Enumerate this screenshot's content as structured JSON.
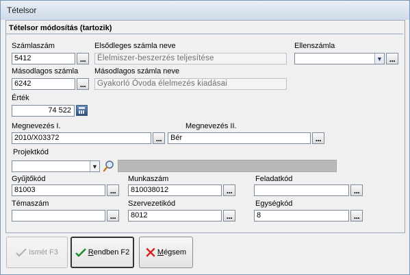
{
  "window": {
    "title": "Tételsor"
  },
  "group": {
    "title": "Tételsor módosítás (tartozik)"
  },
  "fields": {
    "szamlaszam": {
      "label": "Számlaszám",
      "value": "5412"
    },
    "elsodleges": {
      "label": "Elsődleges számla neve",
      "value": "Élelmiszer-beszerzés teljesítése"
    },
    "ellenszamla": {
      "label": "Ellenszámla",
      "value": ""
    },
    "masodlagos": {
      "label": "Másodlagos számla",
      "value": "6242"
    },
    "masodlagos_nev": {
      "label": "Másodlagos számla neve",
      "value": "Gyakorló Óvoda élelmezés kiadásai"
    },
    "ertek": {
      "label": "Érték",
      "value": "74 522"
    },
    "megnevezes1": {
      "label": "Megnevezés I.",
      "value": "2010/X03372"
    },
    "megnevezes2": {
      "label": "Megnevezés II.",
      "value": "Bér"
    },
    "projektkod": {
      "label": "Projektkód",
      "value": ""
    },
    "gyujtokod": {
      "label": "Gyűjtőkód",
      "value": "81003"
    },
    "munkaszam": {
      "label": "Munkaszám",
      "value": "810038012"
    },
    "feladatkod": {
      "label": "Feladatkód",
      "value": ""
    },
    "temaszam": {
      "label": "Témaszám",
      "value": ""
    },
    "szervezetikod": {
      "label": "Szervezetikód",
      "value": "8012"
    },
    "egysegkod": {
      "label": "Egységkód",
      "value": "8"
    }
  },
  "ellipsis": "...",
  "buttons": {
    "ismet": {
      "label": "Ismét F3"
    },
    "rendben_u": "R",
    "rendben_rest": "endben F2",
    "megsem_u": "M",
    "megsem_rest": "égsem"
  }
}
